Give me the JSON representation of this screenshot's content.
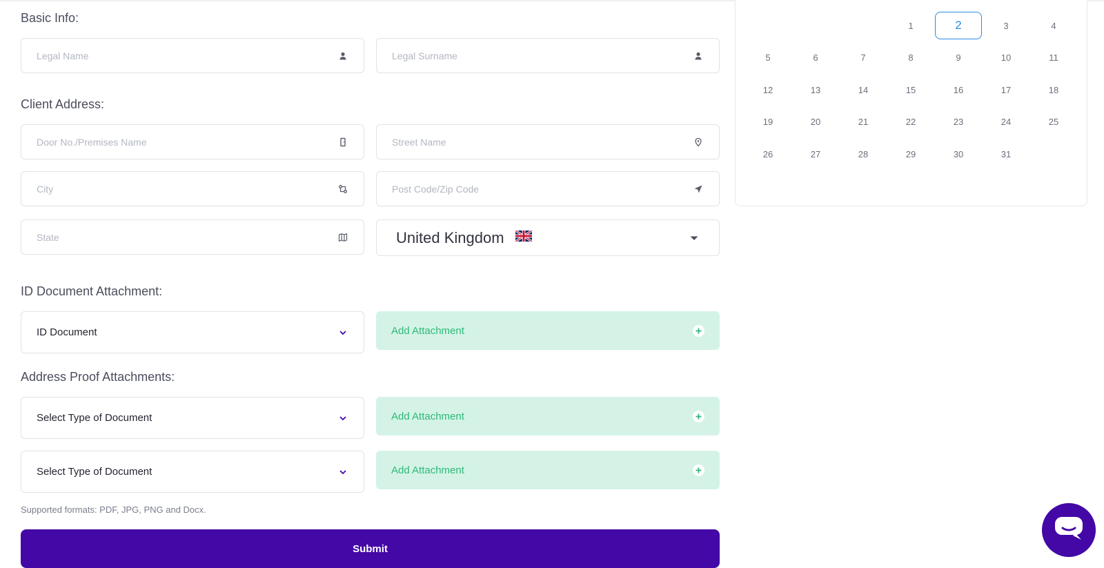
{
  "sections": {
    "basic_info": "Basic Info:",
    "client_address": "Client Address:",
    "id_document": "ID Document Attachment:",
    "address_proof": "Address Proof Attachments:"
  },
  "fields": {
    "legal_name": "Legal Name",
    "legal_surname": "Legal Surname",
    "door_no": "Door No./Premises Name",
    "street_name": "Street Name",
    "city": "City",
    "post_code": "Post Code/Zip Code",
    "state": "State"
  },
  "country": {
    "name": "United Kingdom",
    "flag": "🇬🇧"
  },
  "id_document": {
    "selected": "ID Document",
    "attach_label": "Add Attachment"
  },
  "address_proof": [
    {
      "selected": "Select Type of Document",
      "attach_label": "Add Attachment"
    },
    {
      "selected": "Select Type of Document",
      "attach_label": "Add Attachment"
    }
  ],
  "hint": "Supported formats: PDF, JPG, PNG and Docx.",
  "submit_label": "Submit",
  "calendar": {
    "selected_day": "2",
    "days": [
      "1",
      "2",
      "3",
      "4",
      "5",
      "6",
      "7",
      "8",
      "9",
      "10",
      "11",
      "12",
      "13",
      "14",
      "15",
      "16",
      "17",
      "18",
      "19",
      "20",
      "21",
      "22",
      "23",
      "24",
      "25",
      "26",
      "27",
      "28",
      "29",
      "30",
      "31"
    ]
  },
  "colors": {
    "primary": "#4308a6",
    "attach_bg": "#d4f3e6",
    "attach_text": "#2fb879",
    "selected_day": "#2b8be2"
  }
}
